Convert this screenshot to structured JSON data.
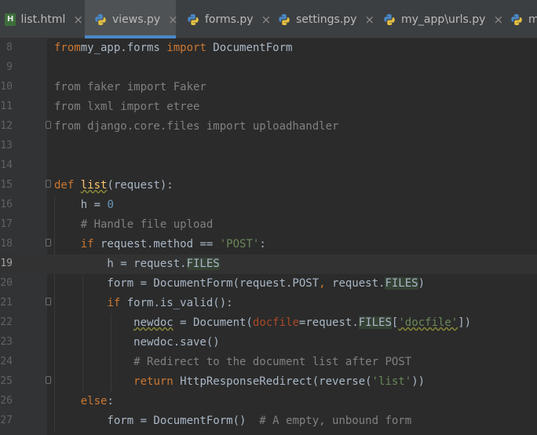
{
  "tabs": [
    {
      "name": "list.html",
      "icon": "html-file-icon",
      "active": false
    },
    {
      "name": "views.py",
      "icon": "python-file-icon",
      "active": true
    },
    {
      "name": "forms.py",
      "icon": "python-file-icon",
      "active": false
    },
    {
      "name": "settings.py",
      "icon": "python-file-icon",
      "active": false
    },
    {
      "name": "my_app\\urls.py",
      "icon": "python-file-icon",
      "active": false
    },
    {
      "name": "m",
      "icon": "python-file-icon",
      "active": false
    }
  ],
  "close_glyph": "×",
  "html_icon_letter": "H",
  "editor": {
    "current_line": 19,
    "lines": [
      {
        "num": "8",
        "code": [
          [
            "kw",
            "from"
          ],
          [
            "",
            "my_app.forms "
          ],
          [
            "kw",
            "import"
          ],
          [
            "",
            " DocumentForm"
          ]
        ]
      },
      {
        "num": "9",
        "code": []
      },
      {
        "num": "10",
        "code": [
          [
            "cm",
            "from faker import Faker"
          ]
        ]
      },
      {
        "num": "11",
        "code": [
          [
            "cm",
            "from lxml import etree"
          ]
        ]
      },
      {
        "num": "12",
        "code": [
          [
            "cm",
            "from django.core.files import uploadhandler"
          ]
        ]
      },
      {
        "num": "13",
        "code": []
      },
      {
        "num": "14",
        "code": []
      },
      {
        "num": "15",
        "code": [
          [
            "kw",
            "def "
          ],
          [
            "fn warn",
            "list"
          ],
          [
            "",
            "(request):"
          ]
        ]
      },
      {
        "num": "16",
        "code": [
          [
            "",
            "    h = "
          ],
          [
            "nm",
            "0"
          ]
        ]
      },
      {
        "num": "17",
        "code": [
          [
            "",
            "    "
          ],
          [
            "cm",
            "# Handle file upload"
          ]
        ]
      },
      {
        "num": "18",
        "code": [
          [
            "",
            "    "
          ],
          [
            "kw",
            "if"
          ],
          [
            "",
            " request.method == "
          ],
          [
            "st",
            "'POST'"
          ],
          [
            "",
            ":"
          ]
        ]
      },
      {
        "num": "19",
        "code": [
          [
            "",
            "        h = request."
          ],
          [
            "hl",
            "FILES"
          ]
        ]
      },
      {
        "num": "20",
        "code": [
          [
            "",
            "        form = DocumentForm(request.POST"
          ],
          [
            "kw",
            ","
          ],
          [
            "",
            " request."
          ],
          [
            "hl",
            "FILES"
          ],
          [
            "",
            ")"
          ]
        ]
      },
      {
        "num": "21",
        "code": [
          [
            "",
            "        "
          ],
          [
            "kw",
            "if"
          ],
          [
            "",
            " form.is_valid():"
          ]
        ]
      },
      {
        "num": "22",
        "code": [
          [
            "",
            "            "
          ],
          [
            "warn",
            "newdoc"
          ],
          [
            "",
            " = Document("
          ],
          [
            "pm",
            "docfile"
          ],
          [
            "",
            "=request."
          ],
          [
            "hl",
            "FILES"
          ],
          [
            "",
            "["
          ],
          [
            "st warn",
            "'docfile'"
          ],
          [
            "",
            "])"
          ]
        ]
      },
      {
        "num": "23",
        "code": [
          [
            "",
            "            newdoc.save()"
          ]
        ]
      },
      {
        "num": "24",
        "code": [
          [
            "",
            "            "
          ],
          [
            "cm",
            "# Redirect to the document list after POST"
          ]
        ]
      },
      {
        "num": "25",
        "code": [
          [
            "",
            "            "
          ],
          [
            "kw",
            "return"
          ],
          [
            "",
            " HttpResponseRedirect(reverse("
          ],
          [
            "st",
            "'list'"
          ],
          [
            "",
            "))"
          ]
        ]
      },
      {
        "num": "26",
        "code": [
          [
            "",
            "    "
          ],
          [
            "kw",
            "else"
          ],
          [
            "",
            ":"
          ]
        ]
      },
      {
        "num": "27",
        "code": [
          [
            "",
            "        form = DocumentForm()  "
          ],
          [
            "cm",
            "# A empty, unbound form"
          ]
        ]
      }
    ]
  }
}
